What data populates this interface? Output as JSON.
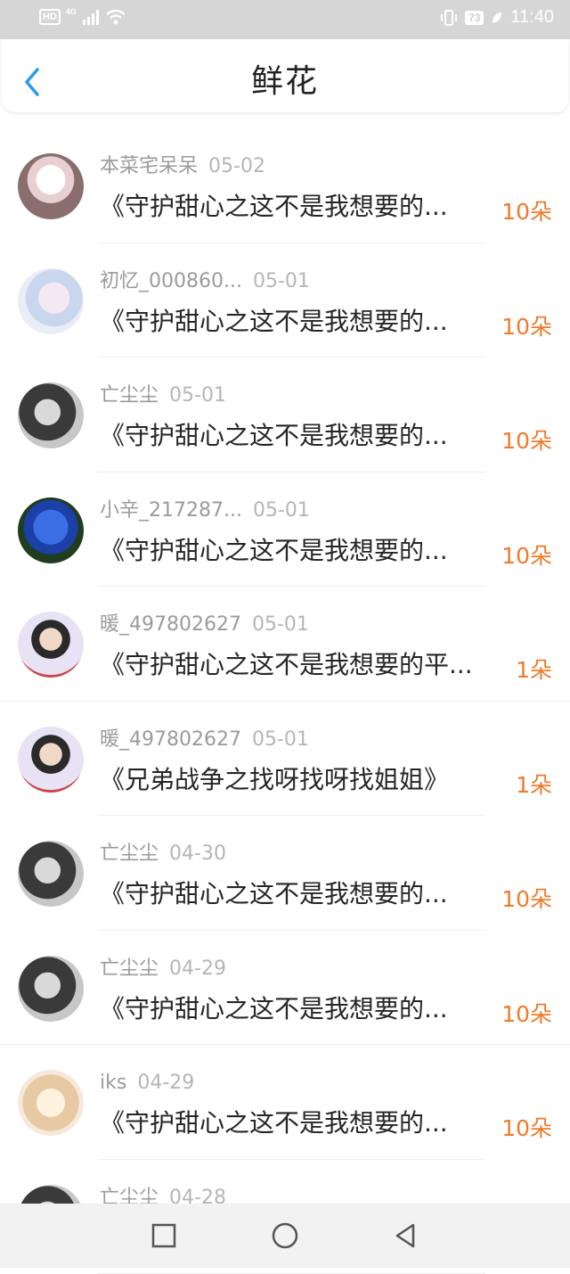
{
  "status_bar": {
    "hd": "HD",
    "network": "4G",
    "battery": "73",
    "time": "11:40"
  },
  "header": {
    "title": "鲜花"
  },
  "items": [
    {
      "user": "本菜宅呆呆",
      "date": "05-02",
      "title": "《守护甜心之这不是我想要的...",
      "amount": "10朵",
      "avatar": "av-a"
    },
    {
      "user": "初忆_000860...",
      "date": "05-01",
      "title": "《守护甜心之这不是我想要的...",
      "amount": "10朵",
      "avatar": "av-b"
    },
    {
      "user": "亡尘尘",
      "date": "05-01",
      "title": "《守护甜心之这不是我想要的...",
      "amount": "10朵",
      "avatar": "av-c"
    },
    {
      "user": "小辛_217287...",
      "date": "05-01",
      "title": "《守护甜心之这不是我想要的...",
      "amount": "10朵",
      "avatar": "av-d"
    },
    {
      "user": "暖_497802627",
      "date": "05-01",
      "title": "《守护甜心之这不是我想要的平...",
      "amount": "1朵",
      "avatar": "av-e"
    },
    {
      "user": "暖_497802627",
      "date": "05-01",
      "title": "《兄弟战争之找呀找呀找姐姐》",
      "amount": "1朵",
      "avatar": "av-e"
    },
    {
      "user": "亡尘尘",
      "date": "04-30",
      "title": "《守护甜心之这不是我想要的...",
      "amount": "10朵",
      "avatar": "av-c"
    },
    {
      "user": "亡尘尘",
      "date": "04-29",
      "title": "《守护甜心之这不是我想要的...",
      "amount": "10朵",
      "avatar": "av-c"
    },
    {
      "user": "iks",
      "date": "04-29",
      "title": "《守护甜心之这不是我想要的...",
      "amount": "10朵",
      "avatar": "av-f"
    },
    {
      "user": "亡尘尘",
      "date": "04-28",
      "title": "",
      "amount": "",
      "avatar": "av-c"
    }
  ],
  "nav_bar": {
    "icons": [
      "square-icon",
      "circle-icon",
      "triangle-back-icon"
    ]
  }
}
